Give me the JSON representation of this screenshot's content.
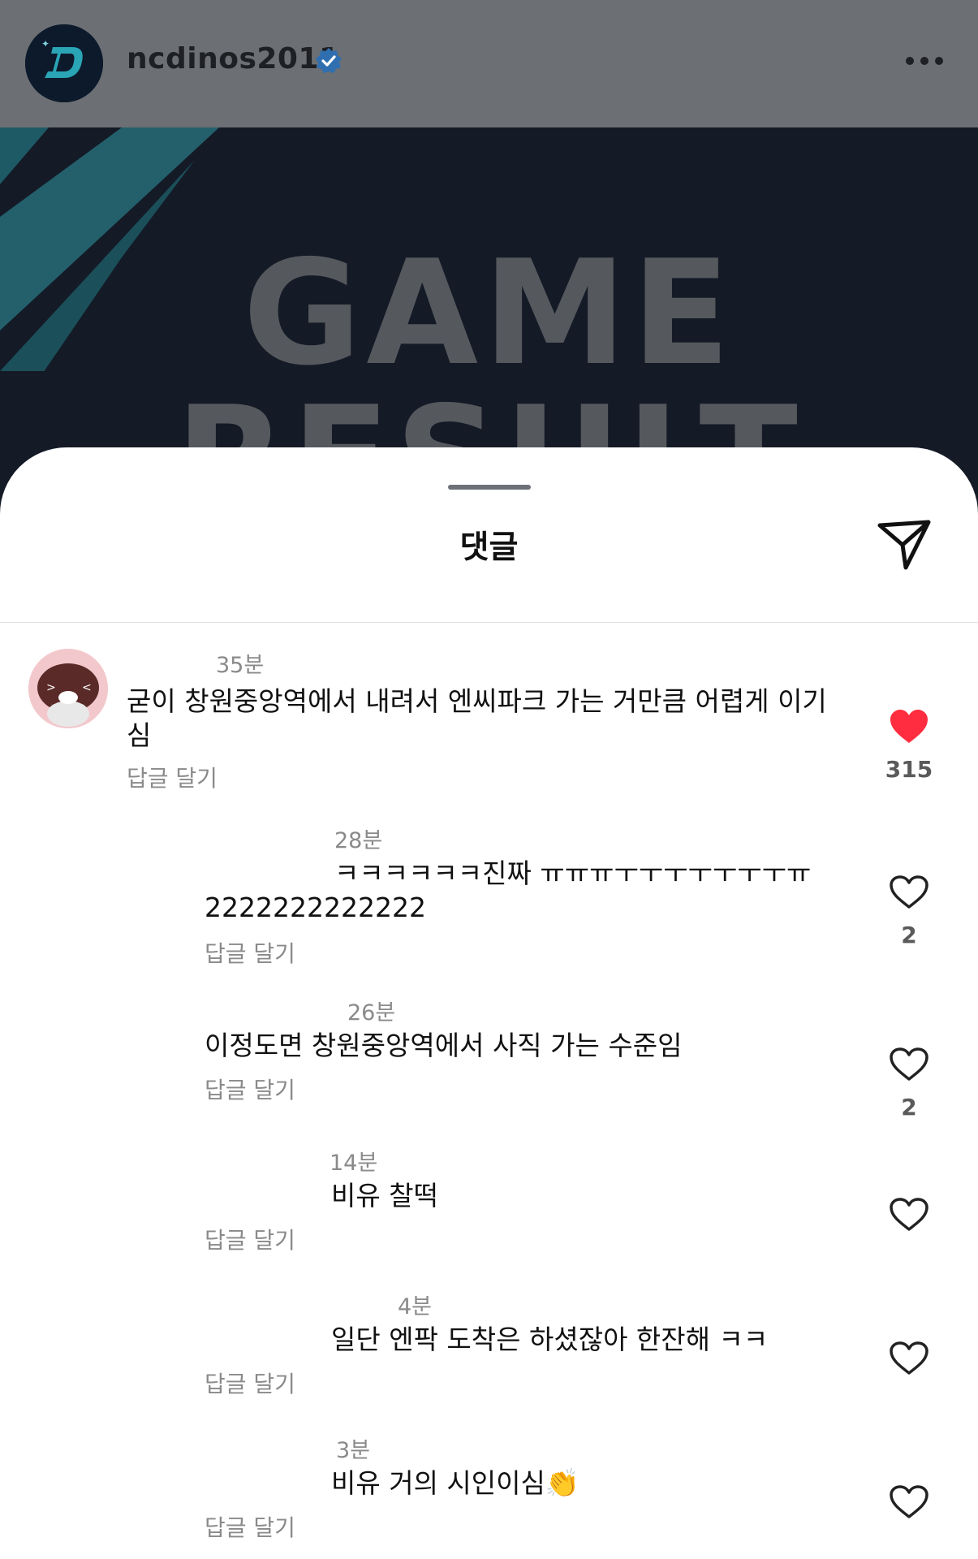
{
  "header": {
    "username": "ncdinos2011",
    "logo_letter": "D"
  },
  "post": {
    "title_line1": "GAME",
    "title_line2": "RESULT"
  },
  "sheet": {
    "title": "댓글"
  },
  "comments": [
    {
      "time": "35분",
      "text_line1": "굳이 창원중앙역에서 내려서 엔씨파크 가는 거만큼 어렵게 이기",
      "text_line2": "심",
      "reply": "답글 달기",
      "likes": "315",
      "liked": true
    },
    {
      "time": "28분",
      "text_line1": "ㅋㅋㅋㅋㅋㅋ진짜 ㅠㅠㅠㅜㅜㅜㅜㅜㅜㅜㅠ",
      "text_line2": "2222222222222",
      "reply": "답글 달기",
      "likes": "2",
      "liked": false
    },
    {
      "time": "26분",
      "text_line1": "이정도면 창원중앙역에서 사직 가는 수준임",
      "reply": "답글 달기",
      "likes": "2",
      "liked": false
    },
    {
      "time": "14분",
      "text_line1": "비유 찰떡",
      "reply": "답글 달기",
      "liked": false
    },
    {
      "time": "4분",
      "text_line1": "일단 엔팍 도착은 하셨잖아 한잔해 ㅋㅋ",
      "reply": "답글 달기",
      "liked": false
    },
    {
      "time": "3분",
      "text_line1": "비유 거의 시인이심",
      "emoji": "👏",
      "reply": "답글 달기",
      "liked": false
    }
  ],
  "colors": {
    "header_bg": "#6c6f73",
    "post_bg": "#141a26",
    "accent_teal": "#2a6f7a",
    "verified_blue": "#2f6fb0",
    "like_red": "#ff2d3f"
  }
}
